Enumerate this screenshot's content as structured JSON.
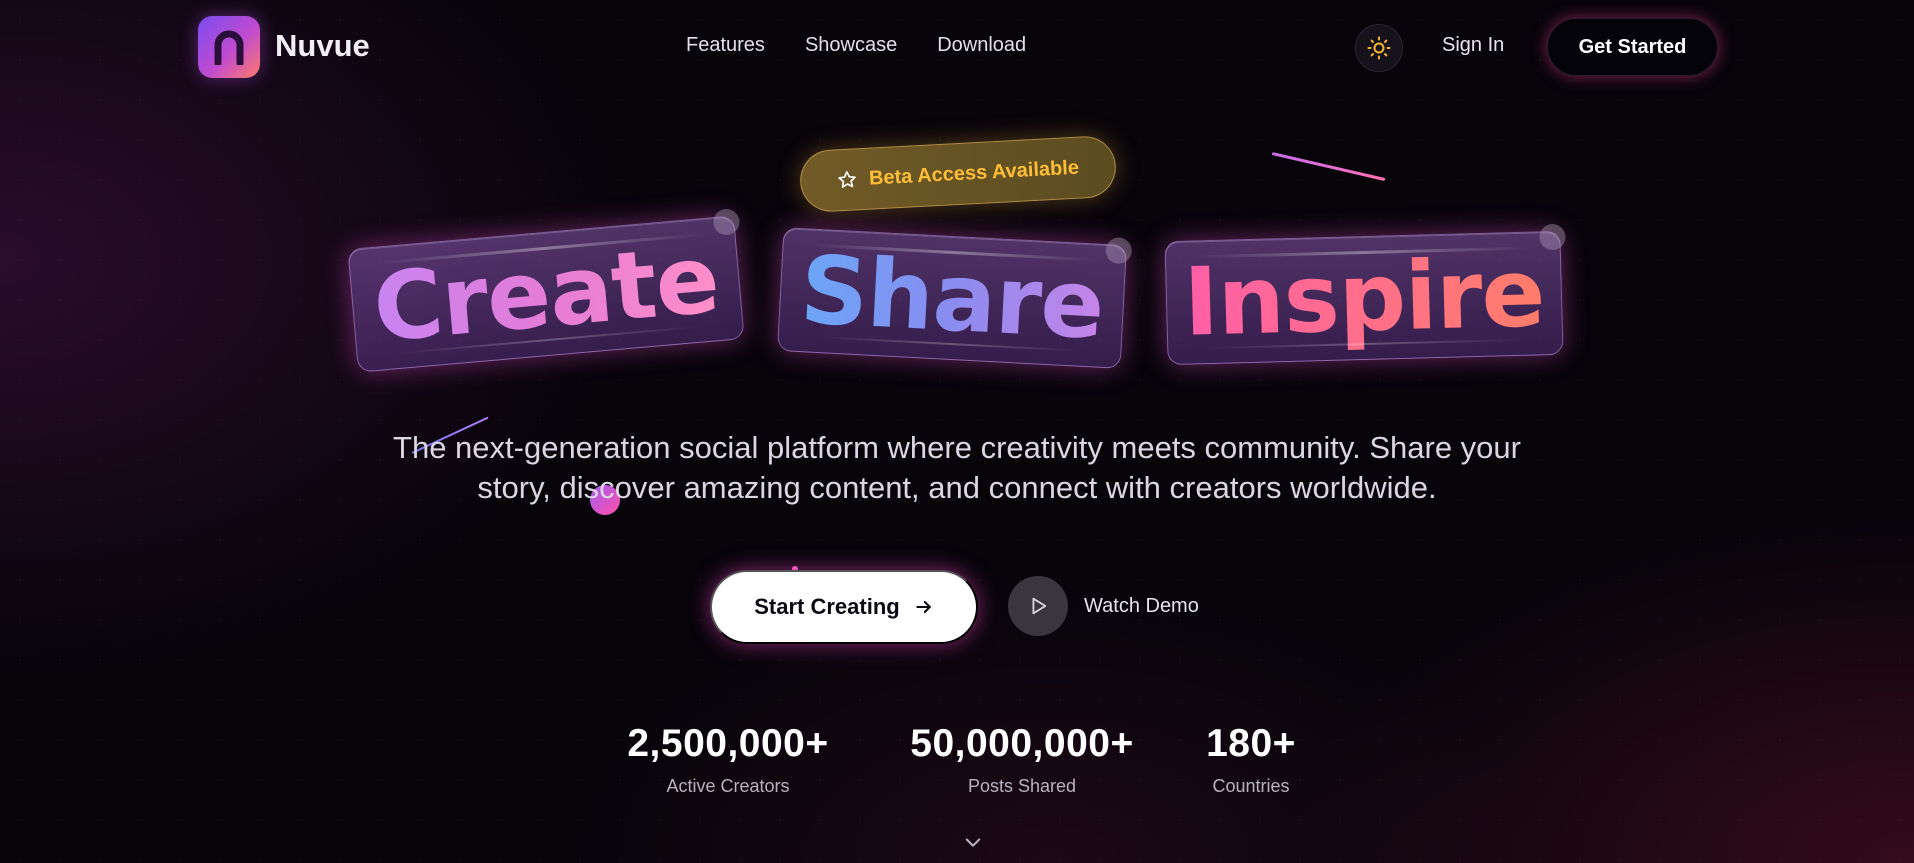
{
  "nav": {
    "brand": "Nuvue",
    "links": [
      "Features",
      "Showcase",
      "Download"
    ],
    "sign_in": "Sign In",
    "get_started": "Get Started",
    "theme_icon": "sun-icon"
  },
  "hero": {
    "badge": "Beta Access Available",
    "words": [
      "Create",
      "Share",
      "Inspire"
    ],
    "tagline": "The next-generation social platform where creativity meets community. Share your story, discover amazing content, and connect with creators worldwide.",
    "primary_cta": "Start Creating",
    "secondary_cta": "Watch Demo"
  },
  "stats": [
    {
      "value": "2,500,000+",
      "label": "Active Creators"
    },
    {
      "value": "50,000,000+",
      "label": "Posts Shared"
    },
    {
      "value": "180+",
      "label": "Countries"
    }
  ],
  "colors": {
    "accent_pink": "#ff5fa7",
    "accent_purple": "#c884f2",
    "accent_blue": "#6aa6f7",
    "badge_gold": "#ffbe37",
    "background": "#07040a"
  }
}
